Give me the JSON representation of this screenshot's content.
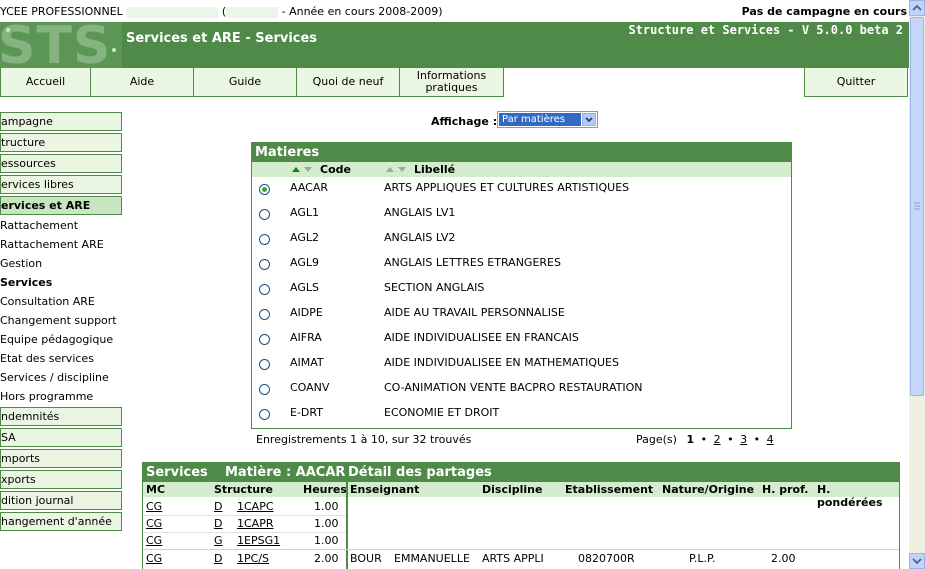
{
  "topbar": {
    "school_prefix": "YCEE PROFESSIONNEL",
    "paren_open": "(",
    "year_text": "- Année en cours 2008-2009)",
    "campaign_status": "Pas de campagne en cours"
  },
  "banner": {
    "logo_text": "STS",
    "version": "Structure et Services - V 5.0.0 beta 2",
    "page_title": "Services et ARE - Services"
  },
  "nav": {
    "accueil": "Accueil",
    "aide": "Aide",
    "guide": "Guide",
    "quoi_de_neuf": "Quoi de neuf",
    "info_line1": "Informations",
    "info_line2": "pratiques",
    "quitter": "Quitter"
  },
  "sidebar": {
    "items": [
      {
        "label": "ampagne"
      },
      {
        "label": "tructure"
      },
      {
        "label": "essources"
      },
      {
        "label": "ervices libres"
      },
      {
        "label": "ervices et ARE"
      }
    ],
    "subitems": [
      {
        "label": "Rattachement"
      },
      {
        "label": "Rattachement ARE"
      },
      {
        "label": "Gestion"
      },
      {
        "label": "Services"
      },
      {
        "label": "Consultation ARE"
      },
      {
        "label": "Changement support"
      },
      {
        "label": "Equipe pédagogique"
      },
      {
        "label": "Etat des services"
      },
      {
        "label": "Services / discipline"
      },
      {
        "label": "Hors programme"
      }
    ],
    "items_bottom": [
      {
        "label": "ndemnités"
      },
      {
        "label": "SA"
      },
      {
        "label": "mports"
      },
      {
        "label": "xports"
      },
      {
        "label": "dition journal"
      },
      {
        "label": "hangement d'année"
      }
    ]
  },
  "affichage": {
    "label": "Affichage :",
    "selected": "Par matières"
  },
  "matieres": {
    "title": "Matieres",
    "col_code": "Code",
    "col_libelle": "Libellé",
    "rows": [
      {
        "code": "AACAR",
        "libelle": "ARTS APPLIQUES ET CULTURES ARTISTIQUES"
      },
      {
        "code": "AGL1",
        "libelle": "ANGLAIS LV1"
      },
      {
        "code": "AGL2",
        "libelle": "ANGLAIS LV2"
      },
      {
        "code": "AGL9",
        "libelle": "ANGLAIS LETTRES ETRANGERES"
      },
      {
        "code": "AGLS",
        "libelle": "SECTION ANGLAIS"
      },
      {
        "code": "AIDPE",
        "libelle": "AIDE AU TRAVAIL PERSONNALISE"
      },
      {
        "code": "AIFRA",
        "libelle": "AIDE INDIVIDUALISEE EN FRANCAIS"
      },
      {
        "code": "AIMAT",
        "libelle": "AIDE INDIVIDUALISEE EN MATHEMATIQUES"
      },
      {
        "code": "COANV",
        "libelle": "CO-ANIMATION VENTE BACPRO RESTAURATION"
      },
      {
        "code": "E-DRT",
        "libelle": "ECONOMIE ET DROIT"
      }
    ],
    "records_text": "Enregistrements 1 à 10, sur 32 trouvés",
    "pages_label": "Page(s)",
    "pages": [
      "1",
      "2",
      "3",
      "4"
    ],
    "page_sep": "•"
  },
  "services": {
    "title": "Services",
    "matiere_title": "Matière : AACAR",
    "detail_title": "Détail des partages",
    "cols": {
      "mc": "MC",
      "structure": "Structure",
      "heures": "Heures"
    },
    "detail_cols": {
      "enseignant": "Enseignant",
      "discipline": "Discipline",
      "etablissement": "Etablissement",
      "nature": "Nature/Origine",
      "hprof": "H. prof.",
      "hpond": "H. pondérées"
    },
    "rows": [
      {
        "mc": "CG",
        "type": "D",
        "structure": "1CAPC",
        "heures": "1.00"
      },
      {
        "mc": "CG",
        "type": "D",
        "structure": "1CAPR",
        "heures": "1.00"
      },
      {
        "mc": "CG",
        "type": "G",
        "structure": "1EPSG1",
        "heures": "1.00"
      },
      {
        "mc": "CG",
        "type": "D",
        "structure": "1PC/S",
        "heures": "2.00"
      }
    ],
    "detail_row": {
      "nom": "BOUR",
      "prenom": "EMMANUELLE",
      "discipline": "ARTS APPLI",
      "etablissement": "0820700R",
      "nature": "P.L.P.",
      "hprof": "2.00"
    }
  }
}
